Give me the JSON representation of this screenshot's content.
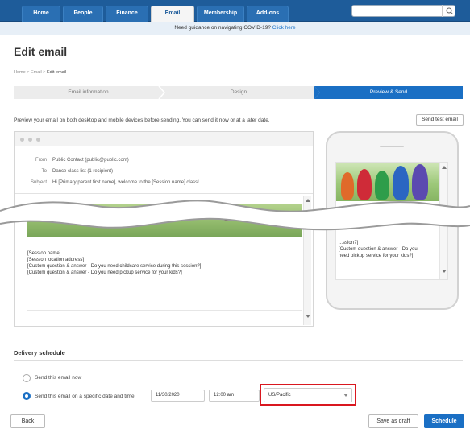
{
  "nav": {
    "tabs": [
      "Home",
      "People",
      "Finance",
      "Email",
      "Membership",
      "Add-ons"
    ],
    "active": "Email",
    "search_placeholder": ""
  },
  "banner": {
    "text": "Need guidance on navigating COVID-19? ",
    "link": "Click here"
  },
  "page": {
    "title": "Edit email"
  },
  "breadcrumb": {
    "home": "Home",
    "sep": " > ",
    "email": "Email",
    "current": "Edit email"
  },
  "steps": [
    {
      "label": "Email information",
      "active": false
    },
    {
      "label": "Design",
      "active": false
    },
    {
      "label": "Preview & Send",
      "active": true
    }
  ],
  "preview": {
    "intro": "Preview your email on both desktop and mobile devices before sending. You can send it now or at a later date.",
    "send_test": "Send test email",
    "from_label": "From",
    "from_value": "Public Contact (public@public.com)",
    "to_label": "To",
    "to_value": "Dance class list (1 recipient)",
    "subject_label": "Subject",
    "subject_value": "Hi [Primary parent first name], welcome to the [Session name] class!",
    "body_lines": [
      "[Session name]",
      "[Session location address]",
      "[Custom question & answer - Do you need childcare service during this session?]",
      "[Custom question & answer - Do you need pickup service for your kids?]"
    ],
    "mobile_lines": [
      "...ssion?]",
      "[Custom question & answer - Do you",
      "need pickup service for your kids?]"
    ]
  },
  "delivery": {
    "title": "Delivery schedule",
    "option_now": "Send this email now",
    "option_scheduled": "Send this email on a specific date and time",
    "date": "11/30/2020",
    "time": "12:00 am",
    "timezone": "US/Pacific"
  },
  "footer": {
    "back": "Back",
    "save_draft": "Save as draft",
    "schedule": "Schedule"
  },
  "colors": {
    "nav": "#1e5c9a",
    "accent": "#1a6fc4",
    "highlight": "#d9171f"
  }
}
